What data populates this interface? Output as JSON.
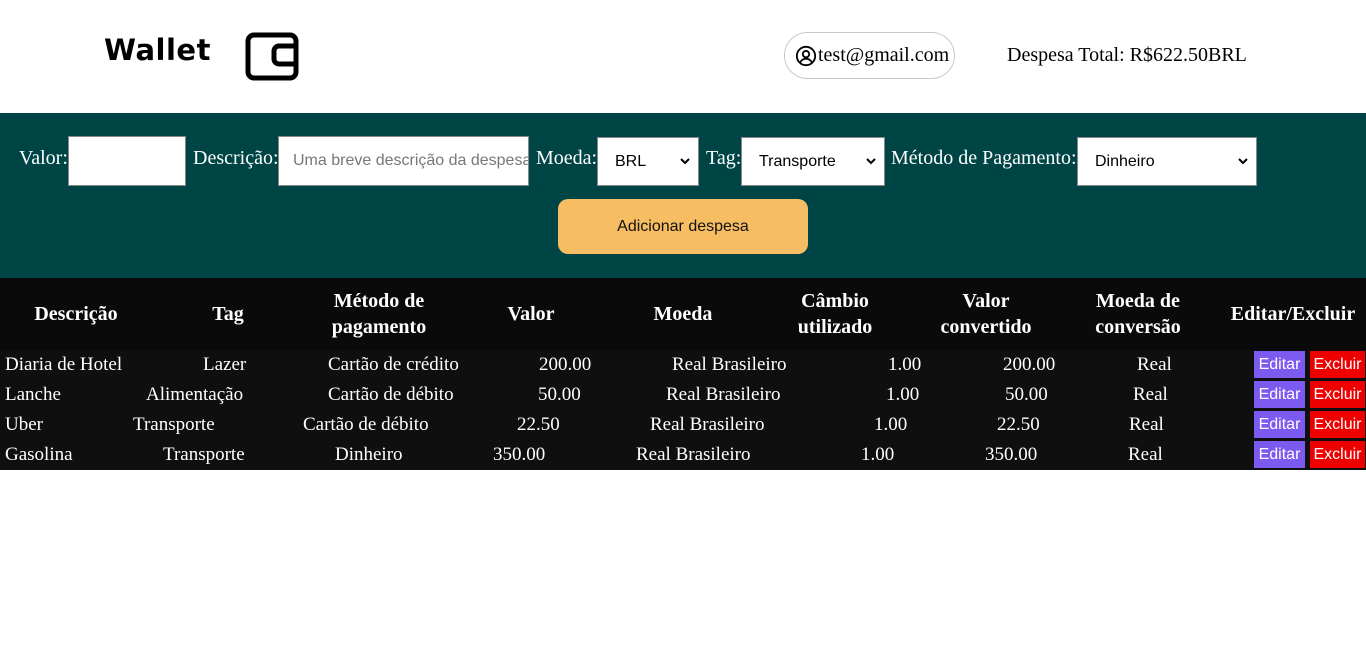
{
  "header": {
    "logo_text": "Wallet",
    "logo_icon": "wallet-icon",
    "user_icon": "user-circle-icon",
    "email": "test@gmail.com",
    "total_text": "Despesa Total: R$622.50BRL"
  },
  "form": {
    "valor_label": "Valor:",
    "valor_value": "",
    "descricao_label": "Descrição:",
    "descricao_placeholder": "Uma breve descrição da despesa",
    "moeda_label": "Moeda:",
    "moeda_selected": "BRL",
    "tag_label": "Tag:",
    "tag_selected": "Transporte",
    "metodo_label": "Método de Pagamento:",
    "metodo_selected": "Dinheiro",
    "submit_label": "Adicionar despesa"
  },
  "table": {
    "headers": [
      "Descrição",
      "Tag",
      "Método de pagamento",
      "Valor",
      "Moeda",
      "Câmbio utilizado",
      "Valor convertido",
      "Moeda de conversão",
      "Editar/Excluir"
    ],
    "rows": [
      {
        "descricao": "Diaria de Hotel",
        "tag": "Lazer",
        "metodo": "Cartão de crédito",
        "valor": "200.00",
        "moeda": "Real Brasileiro",
        "cambio": "1.00",
        "convertido": "200.00",
        "conversao": "Real",
        "edit": "Editar",
        "delete": "Excluir"
      },
      {
        "descricao": "Lanche",
        "tag": "Alimentação",
        "metodo": "Cartão de débito",
        "valor": "50.00",
        "moeda": "Real Brasileiro",
        "cambio": "1.00",
        "convertido": "50.00",
        "conversao": "Real",
        "edit": "Editar",
        "delete": "Excluir"
      },
      {
        "descricao": "Uber",
        "tag": "Transporte",
        "metodo": "Cartão de débito",
        "valor": "22.50",
        "moeda": "Real Brasileiro",
        "cambio": "1.00",
        "convertido": "22.50",
        "conversao": "Real",
        "edit": "Editar",
        "delete": "Excluir"
      },
      {
        "descricao": "Gasolina",
        "tag": "Transporte",
        "metodo": "Dinheiro",
        "valor": "350.00",
        "moeda": "Real Brasileiro",
        "cambio": "1.00",
        "convertido": "350.00",
        "conversao": "Real",
        "edit": "Editar",
        "delete": "Excluir"
      }
    ]
  },
  "colors": {
    "form_background": "#004545",
    "add_button": "#f6bd63",
    "edit_button": "#7c5af0",
    "delete_button": "#ee0000",
    "table_background": "#0a0a0a"
  }
}
